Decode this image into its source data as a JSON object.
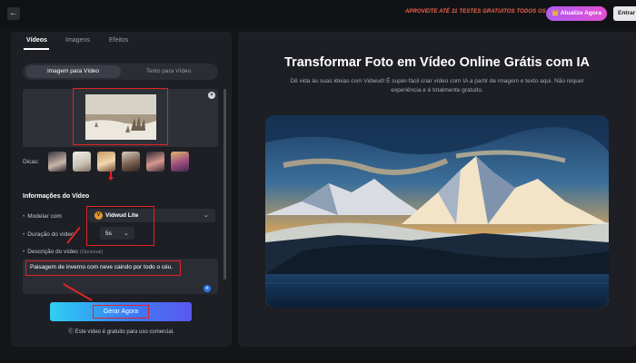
{
  "topbar": {
    "back_icon": "arrow-left-icon",
    "promo_text": "APROVEITE ATÉ 31 TESTES GRATUITOS TODOS OS DIAS!",
    "upgrade_label": "👑 Atualize Agora",
    "login_label": "Entrar"
  },
  "left": {
    "tabs": [
      {
        "label": "Vídeos",
        "active": true
      },
      {
        "label": "Imagens",
        "active": false
      },
      {
        "label": "Efeitos",
        "active": false
      }
    ],
    "mode": {
      "active": "Imagem para Vídeo",
      "inactive": "Texto para Vídeo"
    },
    "upload_close_icon": "×",
    "dicas_label": "Dicas:",
    "dicas_count": 7,
    "section_title": "Informações do Vídeo",
    "model_label": "Modelar com",
    "model_value": "Vidwud Lite",
    "model_logo": "V",
    "duration_label": "Duração do vídeo",
    "duration_value": "5s",
    "desc_label": "Descrição do vídeo",
    "desc_optional": "(Opcional)",
    "desc_value": "Paisagem de inverno com neve caindo por todo o céu.",
    "generate_label": "Gerar Agora",
    "free_note": "Ⓒ Este vídeo é gratuito para uso comercial."
  },
  "right": {
    "title": "Transformar Foto em Vídeo Online Grátis com IA",
    "subtitle_line1": "Dê vida às suas ideias com Vidwud! É super-fácil criar vídeo com IA a partir de imagem e texto aqui. Não requer",
    "subtitle_line2": "experiência e é totalmente gratuito."
  },
  "colors": {
    "accent_red": "#e02424",
    "generate_gradient": [
      "#2ed0f2",
      "#3a7ef5",
      "#5b57f0"
    ],
    "upgrade_gradient": [
      "#b05cf5",
      "#e24fd0"
    ],
    "promo": "#f0664a"
  }
}
